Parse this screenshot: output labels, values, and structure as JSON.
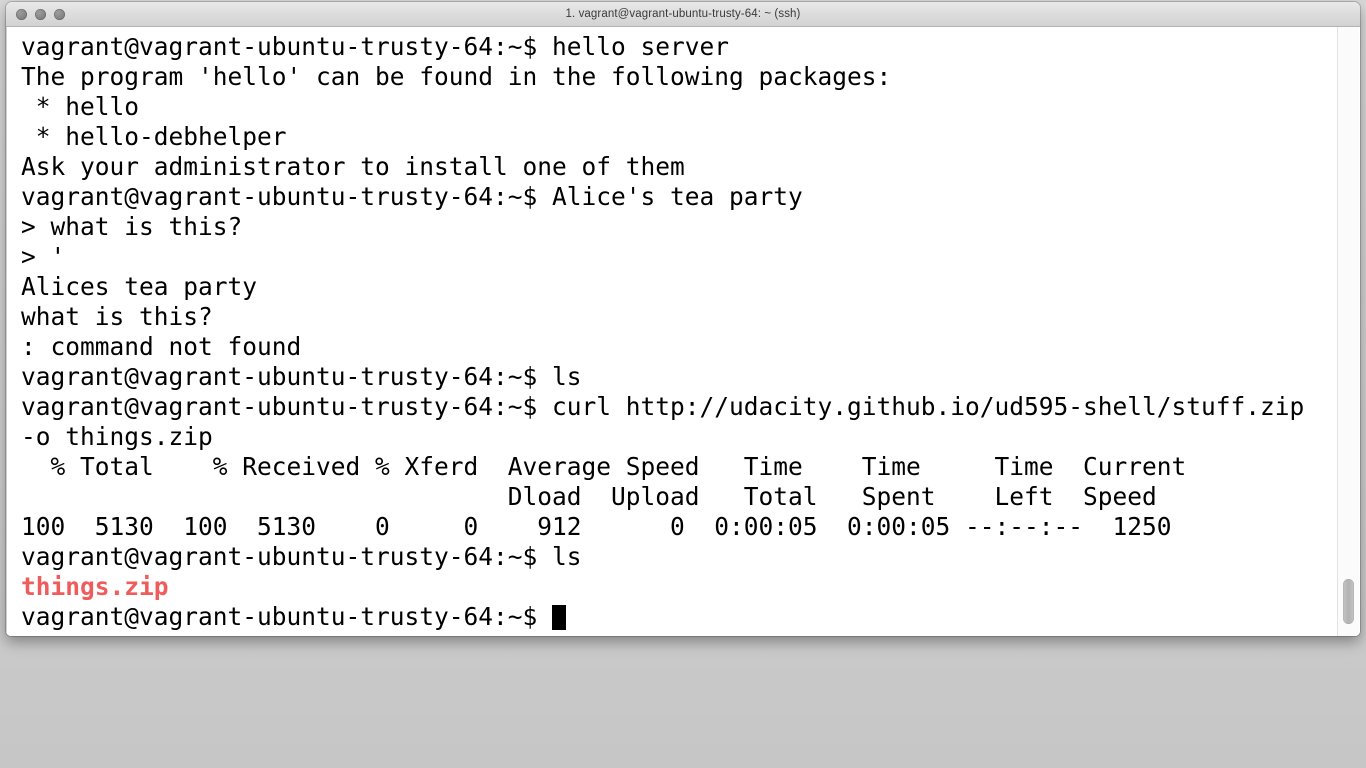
{
  "window": {
    "title": "1. vagrant@vagrant-ubuntu-trusty-64: ~ (ssh)",
    "traffic_lights": [
      {
        "name": "close",
        "color": "#858585"
      },
      {
        "name": "minimize",
        "color": "#858585"
      },
      {
        "name": "zoom",
        "color": "#858585"
      }
    ]
  },
  "colors": {
    "background": "#ffffff",
    "foreground": "#000000",
    "archive_file": "#ee5c5c",
    "titlebar": "#dedede",
    "scrollbar_thumb": "#b2b2b2"
  },
  "terminal": {
    "prompt": "vagrant@vagrant-ubuntu-trusty-64:~$",
    "continuation_prompt": ">",
    "cursor": "block",
    "lines": [
      {
        "id": "line-01",
        "text": "vagrant@vagrant-ubuntu-trusty-64:~$ hello server",
        "color": "foreground"
      },
      {
        "id": "line-02",
        "text": "The program 'hello' can be found in the following packages:",
        "color": "foreground"
      },
      {
        "id": "line-03",
        "text": " * hello",
        "color": "foreground"
      },
      {
        "id": "line-04",
        "text": " * hello-debhelper",
        "color": "foreground"
      },
      {
        "id": "line-05",
        "text": "Ask your administrator to install one of them",
        "color": "foreground"
      },
      {
        "id": "line-06",
        "text": "vagrant@vagrant-ubuntu-trusty-64:~$ Alice's tea party",
        "color": "foreground"
      },
      {
        "id": "line-07",
        "text": "> what is this?",
        "color": "foreground"
      },
      {
        "id": "line-08",
        "text": "> '",
        "color": "foreground"
      },
      {
        "id": "line-09",
        "text": "Alices tea party",
        "color": "foreground"
      },
      {
        "id": "line-10",
        "text": "what is this?",
        "color": "foreground"
      },
      {
        "id": "line-11",
        "text": ": command not found",
        "color": "foreground"
      },
      {
        "id": "line-12",
        "text": "vagrant@vagrant-ubuntu-trusty-64:~$ ls",
        "color": "foreground"
      },
      {
        "id": "line-13",
        "text": "vagrant@vagrant-ubuntu-trusty-64:~$ curl http://udacity.github.io/ud595-shell/stuff.zip",
        "color": "foreground"
      },
      {
        "id": "line-14",
        "text": "-o things.zip",
        "color": "foreground"
      },
      {
        "id": "line-15",
        "text": "  % Total    % Received % Xferd  Average Speed   Time    Time     Time  Current",
        "color": "foreground"
      },
      {
        "id": "line-16",
        "text": "                                 Dload  Upload   Total   Spent    Left  Speed",
        "color": "foreground"
      },
      {
        "id": "line-17",
        "text": "100  5130  100  5130    0     0    912      0  0:00:05  0:00:05 --:--:--  1250",
        "color": "foreground"
      },
      {
        "id": "line-18",
        "text": "vagrant@vagrant-ubuntu-trusty-64:~$ ls",
        "color": "foreground"
      },
      {
        "id": "line-19",
        "text": "things.zip",
        "color": "archive_file"
      },
      {
        "id": "line-20",
        "text": "vagrant@vagrant-ubuntu-trusty-64:~$ ",
        "color": "foreground",
        "cursor": true
      }
    ],
    "commands_run": [
      "hello server",
      "Alice's tea party",
      "ls",
      "curl http://udacity.github.io/ud595-shell/stuff.zip -o things.zip",
      "ls"
    ],
    "download": {
      "url": "http://udacity.github.io/ud595-shell/stuff.zip",
      "output_file": "things.zip",
      "percent_total": "100",
      "total_bytes": "5130",
      "percent_received": "100",
      "received_bytes": "5130",
      "percent_xferd": "0",
      "xferd_bytes": "0",
      "average_dload": "912",
      "average_upload": "0",
      "time_total": "0:00:05",
      "time_spent": "0:00:05",
      "time_left": "--:--:--",
      "current_speed": "1250"
    }
  },
  "scrollbar": {
    "position": "bottom",
    "thumb_label": "vertical-scroll-thumb"
  }
}
